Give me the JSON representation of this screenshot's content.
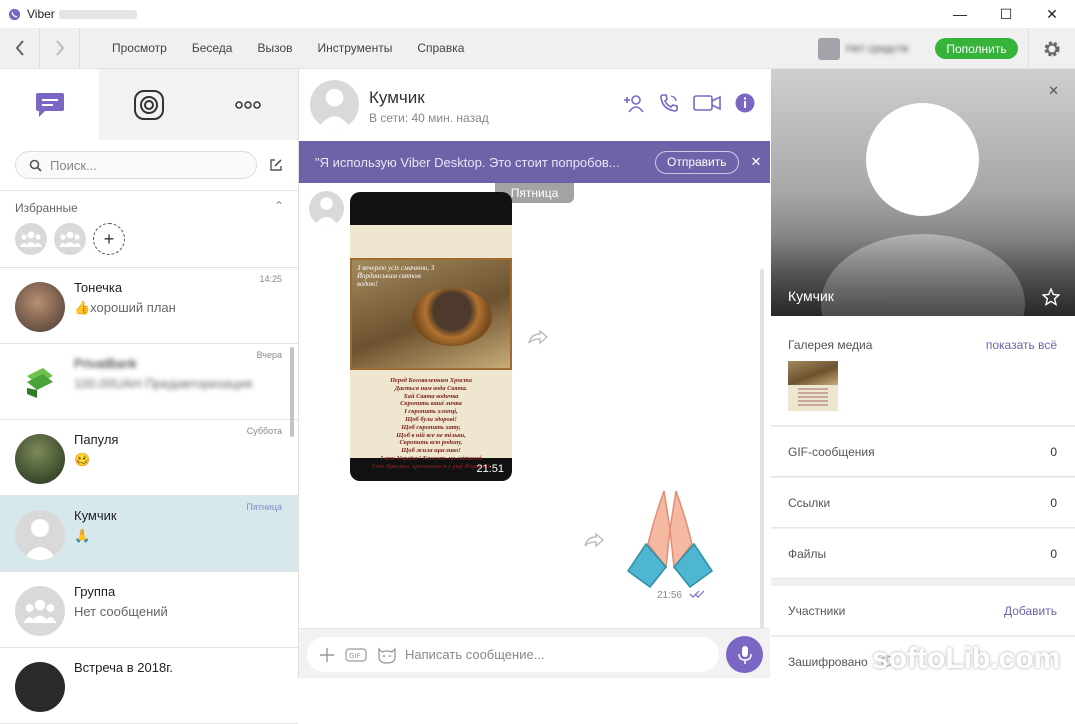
{
  "window": {
    "title": "Viber"
  },
  "menu": {
    "items": [
      "Просмотр",
      "Беседа",
      "Вызов",
      "Инструменты",
      "Справка"
    ],
    "balance": "Нет средств",
    "topup": "Пополнить"
  },
  "sidebar": {
    "search_placeholder": "Поиск...",
    "favorites_label": "Избранные",
    "chats": [
      {
        "name": "Тонечка",
        "preview": "👍хороший план",
        "time": "14:25"
      },
      {
        "name": "PrivatBank",
        "preview": "100.00UAH Предавторизация",
        "time": "Вчера"
      },
      {
        "name": "Папуля",
        "preview": "🥴",
        "time": "Суббота"
      },
      {
        "name": "Кумчик",
        "preview": "🙏",
        "time": "Пятница"
      },
      {
        "name": "Группа",
        "preview": "Нет сообщений",
        "time": ""
      },
      {
        "name": "Встреча в 2018г.",
        "preview": "",
        "time": ""
      }
    ]
  },
  "chat": {
    "name": "Кумчик",
    "status": "В сети: 40 мин. назад",
    "banner_text": "\"Я использую Viber Desktop. Это стоит попробов...",
    "banner_button": "Отправить",
    "day_label": "Пятница",
    "photo_caption_top": "З вечерею усіх смачною, З Йорданським святом водою!",
    "photo_poem": "Перед Богоявленням Христа\nДається нам вода Свята.\nХай Свята водичка\nСкропить ваші личка\nІ скропить хлопці,\nЩоб були здорові!\nЩоб скропить хату,\nЩоб в ній все не тільки,\nСкропить всю родину,\nЩоб жила щасливо!\nІ всю Україну! Кажуть на світанні\nСам Христос хреститься у ріці Йордані!",
    "photo_time": "21:51",
    "sticker_time": "21:56",
    "input_placeholder": "Написать сообщение..."
  },
  "info": {
    "name": "Кумчик",
    "gallery_label": "Галерея медиа",
    "gallery_show": "показать всё",
    "rows": [
      {
        "label": "GIF-сообщения",
        "value": "0"
      },
      {
        "label": "Ссылки",
        "value": "0"
      },
      {
        "label": "Файлы",
        "value": "0"
      }
    ],
    "members_label": "Участники",
    "members_add": "Добавить",
    "encrypted_label": "Зашифровано"
  },
  "watermark": "softoLib.com",
  "colors": {
    "brand": "#7b66c4",
    "banner": "#6e63a9",
    "topup": "#35b33a",
    "active_chat": "#d6e8ec"
  }
}
